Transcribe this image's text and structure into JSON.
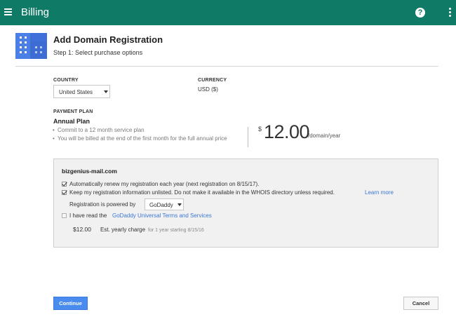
{
  "appbar": {
    "title": "Billing",
    "menu_icon": "hamburger-menu-icon",
    "help_icon": "help-circle-icon",
    "help_glyph": "?",
    "more_icon": "more-vert-icon",
    "color": "#0f7b67"
  },
  "header": {
    "icon": "building-icon",
    "icon_color": "#3f6fd8",
    "title": "Add Domain Registration",
    "subtitle": "Step 1: Select purchase options"
  },
  "country": {
    "label": "COUNTRY",
    "value": "United States"
  },
  "currency": {
    "label": "CURRENCY",
    "value": "USD ($)"
  },
  "payment_plan": {
    "label": "PAYMENT PLAN",
    "name": "Annual Plan",
    "bullets": [
      "Commit to a 12 month service plan",
      "You will be billed at the end of the first month for the full annual price"
    ],
    "currency_symbol": "$",
    "price": "12.00",
    "unit": "/domain/year"
  },
  "registration": {
    "domain": "bizgenius-mail.com",
    "auto_renew": {
      "checked": true,
      "label": "Automatically renew my registration each year (next registration on 8/15/17)."
    },
    "unlisted": {
      "checked": true,
      "label": "Keep my registration information unlisted. Do not make it available in the WHOIS directory unless required.",
      "link": "Learn more"
    },
    "powered_by_label": "Registration is powered by",
    "provider": "GoDaddy",
    "terms": {
      "checked": false,
      "label": "I have read the",
      "link": "GoDaddy Universal Terms and Services"
    },
    "charge_amount": "$12.00",
    "charge_label": "Est. yearly charge",
    "charge_detail": "for 1 year starting 8/15/16"
  },
  "actions": {
    "continue_label": "Continue",
    "cancel_label": "Cancel",
    "primary_color": "#4a8bf0",
    "link_color": "#3a77d8"
  }
}
